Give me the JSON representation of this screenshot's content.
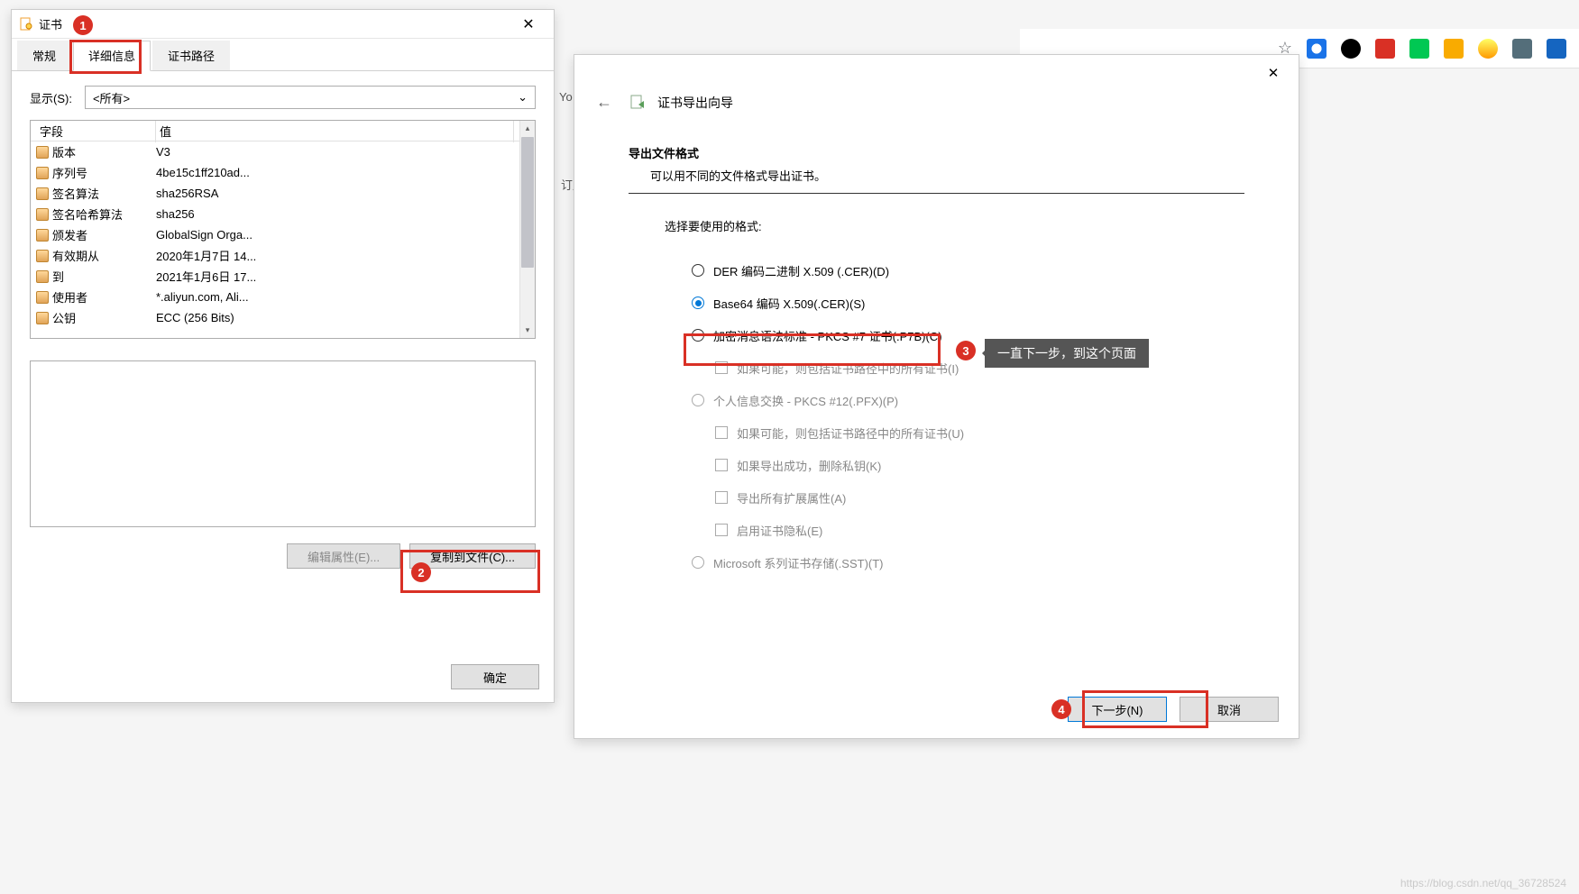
{
  "bg": {
    "text1": "Yo",
    "text2": "订月"
  },
  "browser": {
    "star": "☆"
  },
  "window1": {
    "title": "证书",
    "tabs": {
      "general": "常规",
      "details": "详细信息",
      "path": "证书路径"
    },
    "show_label": "显示(S):",
    "show_value": "<所有>",
    "table_headers": {
      "field": "字段",
      "value": "值"
    },
    "rows": [
      {
        "field": "版本",
        "value": "V3"
      },
      {
        "field": "序列号",
        "value": "4be15c1ff210ad..."
      },
      {
        "field": "签名算法",
        "value": "sha256RSA"
      },
      {
        "field": "签名哈希算法",
        "value": "sha256"
      },
      {
        "field": "颁发者",
        "value": "GlobalSign Orga..."
      },
      {
        "field": "有效期从",
        "value": "2020年1月7日 14..."
      },
      {
        "field": "到",
        "value": "2021年1月6日 17..."
      },
      {
        "field": "使用者",
        "value": "*.aliyun.com, Ali..."
      },
      {
        "field": "公钥",
        "value": "ECC (256 Bits)"
      }
    ],
    "btn_edit": "编辑属性(E)...",
    "btn_copy": "复制到文件(C)...",
    "btn_ok": "确定"
  },
  "window2": {
    "title": "证书导出向导",
    "section_title": "导出文件格式",
    "section_sub": "可以用不同的文件格式导出证书。",
    "format_label": "选择要使用的格式:",
    "opt_der": "DER 编码二进制 X.509 (.CER)(D)",
    "opt_base64": "Base64 编码 X.509(.CER)(S)",
    "opt_pkcs7": "加密消息语法标准 - PKCS #7 证书(.P7B)(C)",
    "chk_pkcs7_1": "如果可能，则包括证书路径中的所有证书(I)",
    "opt_pkcs12": "个人信息交换 - PKCS #12(.PFX)(P)",
    "chk_pkcs12_1": "如果可能，则包括证书路径中的所有证书(U)",
    "chk_pkcs12_2": "如果导出成功，删除私钥(K)",
    "chk_pkcs12_3": "导出所有扩展属性(A)",
    "chk_pkcs12_4": "启用证书隐私(E)",
    "opt_sst": "Microsoft 系列证书存储(.SST)(T)",
    "btn_next": "下一步(N)",
    "btn_cancel": "取消"
  },
  "annotations": {
    "m1": "1",
    "m2": "2",
    "m3": "3",
    "m4": "4",
    "tooltip": "一直下一步，到这个页面"
  },
  "watermark": "https://blog.csdn.net/qq_36728524"
}
